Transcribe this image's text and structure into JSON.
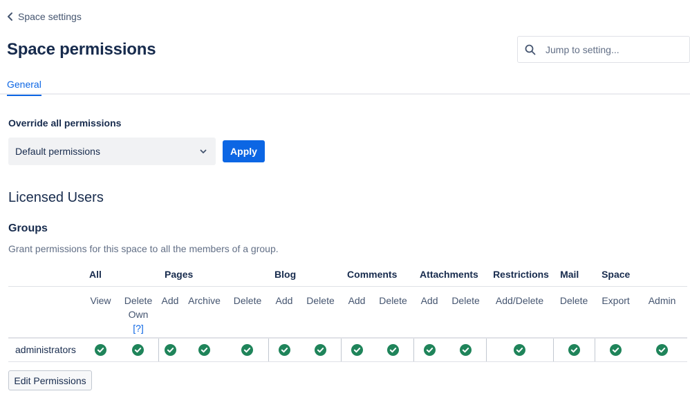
{
  "nav": {
    "back_label": "Space settings"
  },
  "page": {
    "title": "Space permissions"
  },
  "search": {
    "placeholder": "Jump to setting..."
  },
  "tabs": [
    {
      "label": "General",
      "active": true
    }
  ],
  "override": {
    "label": "Override all permissions",
    "selected": "Default permissions",
    "apply_label": "Apply"
  },
  "licensed_users": {
    "title": "Licensed Users",
    "groups_title": "Groups",
    "groups_description": "Grant permissions for this space to all the members of a group."
  },
  "table": {
    "categories": [
      "All",
      "Pages",
      "Blog",
      "Comments",
      "Attachments",
      "Restrictions",
      "Mail",
      "Space"
    ],
    "sub": {
      "view": "View",
      "delete_own": "Delete Own",
      "help": "[?]",
      "pages_add": "Add",
      "pages_archive": "Archive",
      "pages_delete": "Delete",
      "blog_add": "Add",
      "blog_delete": "Delete",
      "comments_add": "Add",
      "comments_delete": "Delete",
      "attachments_add": "Add",
      "attachments_delete": "Delete",
      "restrictions_add_delete": "Add/Delete",
      "mail_delete": "Delete",
      "space_export": "Export",
      "space_admin": "Admin"
    },
    "rows": [
      {
        "name": "administrators",
        "granted": [
          true,
          true,
          true,
          true,
          true,
          true,
          true,
          true,
          true,
          true,
          true,
          true,
          true,
          true,
          true,
          true
        ]
      }
    ]
  },
  "edit_button": "Edit Permissions",
  "colors": {
    "primary": "#0c66e4",
    "check": "#1f845a"
  },
  "icons": {
    "back": "chevron-left-icon",
    "search": "search-icon",
    "select": "chevron-down-icon",
    "check": "check-circle-icon"
  }
}
